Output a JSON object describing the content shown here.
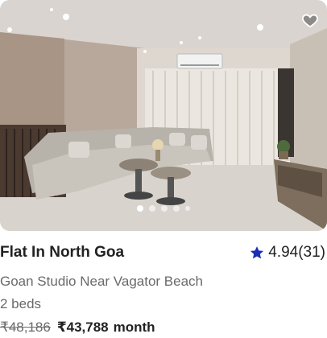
{
  "listing": {
    "title": "Flat In North Goa",
    "rating": "4.94(31)",
    "subtitle": "Goan Studio Near Vagator Beach",
    "beds": "2 beds",
    "old_price": "₹48,186",
    "new_price": "₹43,788",
    "price_unit": "month"
  },
  "carousel": {
    "dot_count": 5,
    "active_index": 0
  },
  "colors": {
    "star": "#1a2fb5",
    "text": "#222222",
    "muted": "#6a6a6a"
  },
  "icons": [
    "heart-icon",
    "star-icon"
  ]
}
